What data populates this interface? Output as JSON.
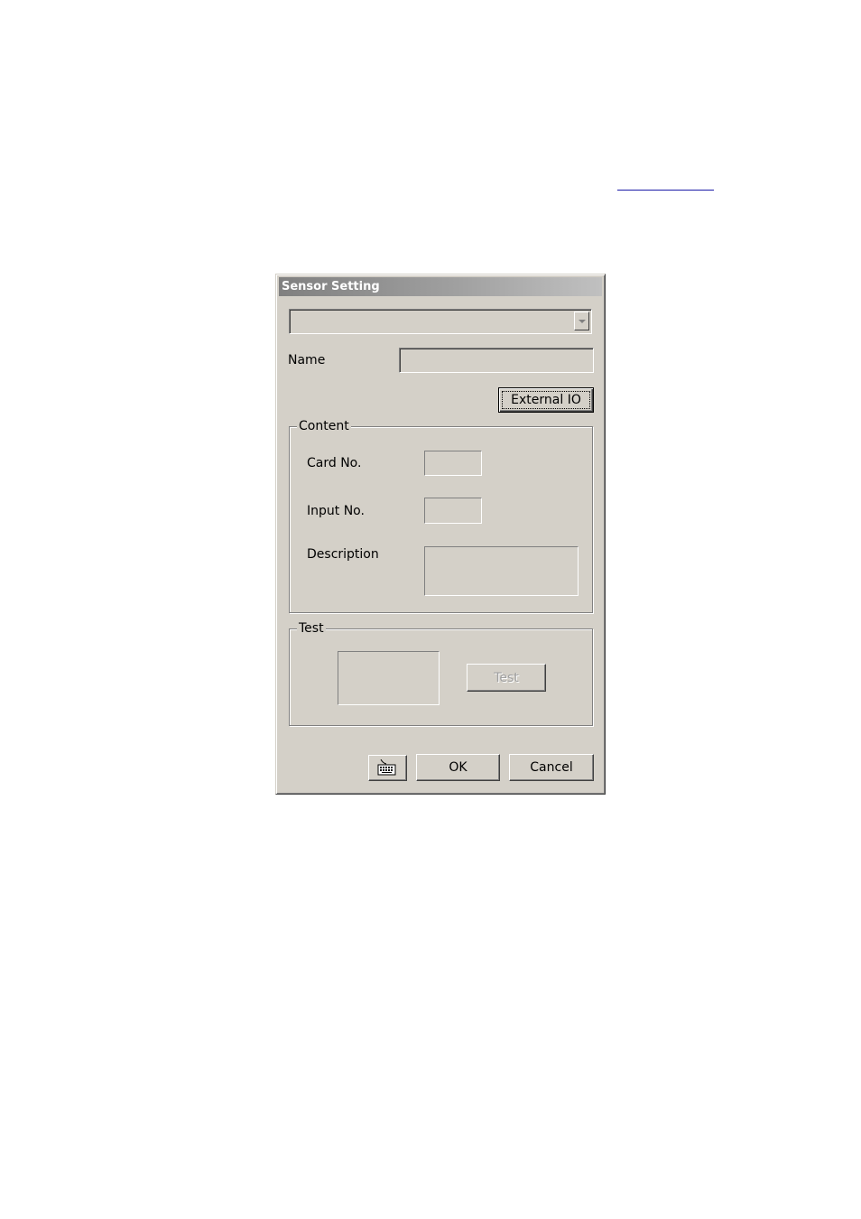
{
  "window": {
    "title": "Sensor Setting"
  },
  "combo": {
    "selected": ""
  },
  "name": {
    "label": "Name",
    "value": ""
  },
  "buttons": {
    "external_io": "External IO",
    "test": "Test",
    "ok": "OK",
    "cancel": "Cancel",
    "keyboard_icon": "keyboard-icon"
  },
  "content": {
    "caption": "Content",
    "card_no_label": "Card No.",
    "card_no_value": "",
    "input_no_label": "Input No.",
    "input_no_value": "",
    "description_label": "Description",
    "description_value": ""
  },
  "test": {
    "caption": "Test"
  },
  "colors": {
    "dialog_face": "#d4d0c8",
    "title_inactive": "#808080",
    "link_underline": "#1a1aa6"
  }
}
